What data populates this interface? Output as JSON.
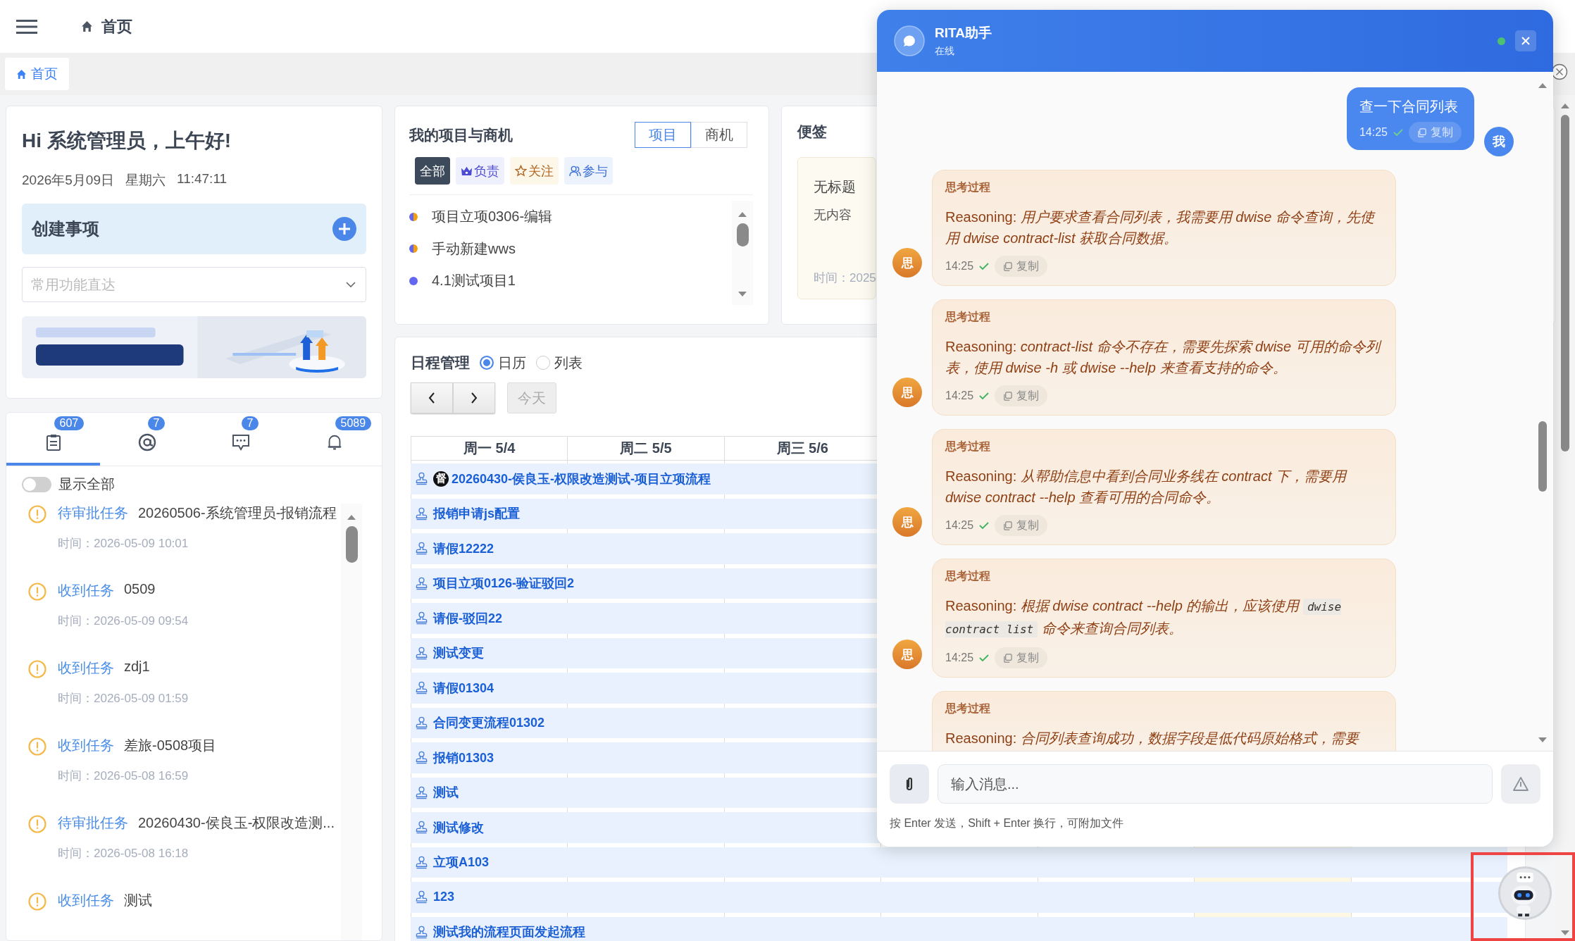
{
  "topbar": {
    "title": "首页"
  },
  "tabs": [
    {
      "label": "首页",
      "selected": true
    }
  ],
  "welcome": {
    "greeting": "Hi 系统管理员，上午好!",
    "date": "2026年5月09日",
    "weekday": "星期六",
    "time": "11:47:11",
    "create_label": "创建事项",
    "quick_select": {
      "placeholder": "常用功能直达"
    }
  },
  "inbox": {
    "tabs": [
      {
        "kind": "todo",
        "badge": "607",
        "selected": true
      },
      {
        "kind": "mention",
        "badge": "7",
        "selected": false
      },
      {
        "kind": "chat",
        "badge": "7",
        "selected": false
      },
      {
        "kind": "notice",
        "badge": "5089",
        "selected": false
      }
    ],
    "show_all": {
      "label": "显示全部",
      "on": false
    },
    "items": [
      {
        "tag": "待审批任务",
        "title": "20260506-系统管理员-报销流程",
        "time": "时间：2026-05-09 10:01"
      },
      {
        "tag": "收到任务",
        "title": "0509",
        "time": "时间：2026-05-09 09:54"
      },
      {
        "tag": "收到任务",
        "title": "zdj1",
        "time": "时间：2026-05-09 01:59"
      },
      {
        "tag": "收到任务",
        "title": "差旅-0508项目",
        "time": "时间：2026-05-08 16:59"
      },
      {
        "tag": "待审批任务",
        "title": "20260430-侯良玉-权限改造测...",
        "time": "时间：2026-05-08 16:18"
      },
      {
        "tag": "收到任务",
        "title": "测试"
      }
    ]
  },
  "projects": {
    "title": "我的项目与商机",
    "switch": [
      {
        "label": "项目",
        "selected": true
      },
      {
        "label": "商机",
        "selected": false
      }
    ],
    "filters": [
      {
        "kind": "all",
        "label": "全部",
        "selected": true
      },
      {
        "kind": "owner",
        "label": "负责",
        "selected": false
      },
      {
        "kind": "follow",
        "label": "关注",
        "selected": false
      },
      {
        "kind": "participate",
        "label": "参与",
        "selected": false
      }
    ],
    "items": [
      {
        "name": "项目立项0306-编辑",
        "kind": "mixed"
      },
      {
        "name": "手动新建wws",
        "kind": "mixed"
      },
      {
        "name": "4.1测试项目1",
        "kind": "single"
      }
    ]
  },
  "notes": {
    "title": "便签",
    "note": {
      "title": "无标题",
      "content": "无内容",
      "time": "时间：2025"
    }
  },
  "schedule": {
    "title": "日程管理",
    "views": [
      {
        "label": "日历",
        "selected": true
      },
      {
        "label": "列表",
        "selected": false
      }
    ],
    "today_label": "今天",
    "columns": [
      {
        "label": "周一 5/4",
        "today": false
      },
      {
        "label": "周二 5/5",
        "today": false
      },
      {
        "label": "周三 5/6",
        "today": false
      },
      {
        "today": false
      },
      {
        "today": false
      },
      {
        "today": true
      },
      {
        "today": false
      }
    ],
    "events": [
      {
        "title": "20260430-侯良玉-权限改造测试-项目立项流程",
        "badge": "督"
      },
      {
        "title": "报销申请js配置"
      },
      {
        "title": "请假12222"
      },
      {
        "title": "项目立项0126-验证驳回2"
      },
      {
        "title": "请假-驳回22"
      },
      {
        "title": "测试变更"
      },
      {
        "title": "请假01304"
      },
      {
        "title": "合同变更流程01302"
      },
      {
        "title": "报销01303"
      },
      {
        "title": "测试"
      },
      {
        "title": "测试修改"
      },
      {
        "title": "立项A103"
      },
      {
        "title": "123"
      },
      {
        "title": "测试我的流程页面发起流程"
      }
    ]
  },
  "chat": {
    "title": "RITA助手",
    "status": "在线",
    "online": true,
    "messages": [
      {
        "kind": "user",
        "text": "查一下合同列表",
        "time": "14:25",
        "copy_label": "复制",
        "avatar": "我"
      },
      {
        "kind": "thinking",
        "label": "思考过程",
        "parts": [
          {
            "kind": "plain",
            "text": "Reasoning: "
          },
          {
            "kind": "italic",
            "text": "用户要求查看合同列表，我需要用 dwise 命令查询，先使用 dwise contract-list 获取合同数据。"
          }
        ],
        "time": "14:25",
        "copy_label": "复制",
        "avatar": "思"
      },
      {
        "kind": "thinking",
        "label": "思考过程",
        "parts": [
          {
            "kind": "plain",
            "text": "Reasoning: "
          },
          {
            "kind": "italic",
            "text": "contract-list 命令不存在，需要先探索 dwise 可用的命令列表，使用 dwise -h 或 dwise --help 来查看支持的命令。"
          }
        ],
        "time": "14:25",
        "copy_label": "复制",
        "avatar": "思"
      },
      {
        "kind": "thinking",
        "label": "思考过程",
        "parts": [
          {
            "kind": "plain",
            "text": "Reasoning: "
          },
          {
            "kind": "italic",
            "text": "从帮助信息中看到合同业务线在 contract 下，需要用 dwise contract --help 查看可用的合同命令。"
          }
        ],
        "time": "14:25",
        "copy_label": "复制",
        "avatar": "思"
      },
      {
        "kind": "thinking",
        "label": "思考过程",
        "parts": [
          {
            "kind": "plain",
            "text": "Reasoning: "
          },
          {
            "kind": "italic",
            "text": "根据 dwise contract --help 的输出，应该使用 "
          },
          {
            "kind": "code",
            "text": "dwise contract list"
          },
          {
            "kind": "italic",
            "text": " 命令来查询合同列表。"
          }
        ],
        "time": "14:25",
        "copy_label": "复制",
        "avatar": "思"
      },
      {
        "kind": "thinking",
        "label": "思考过程",
        "parts": [
          {
            "kind": "plain",
            "text": "Reasoning: "
          },
          {
            "kind": "italic",
            "text": "合同列表查询成功，数据字段是低代码原始格式，需要"
          }
        ]
      }
    ],
    "input": {
      "placeholder": "输入消息..."
    },
    "hint": "按 Enter 发送，Shift + Enter 换行，可附加文件"
  }
}
